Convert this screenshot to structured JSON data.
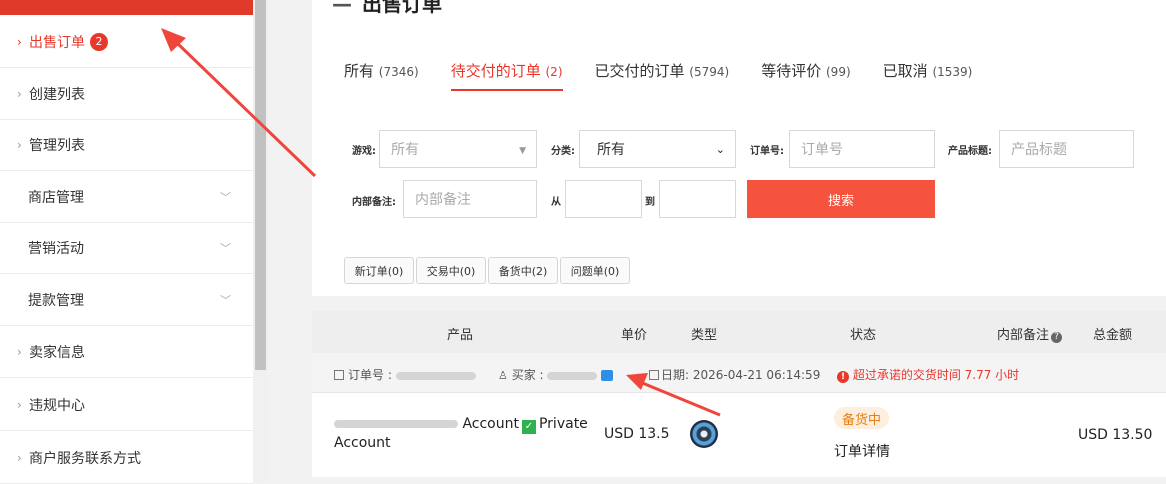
{
  "sidebar": {
    "items": [
      {
        "label": "出售订单",
        "badge": "2"
      },
      {
        "label": "创建列表"
      },
      {
        "label": "管理列表"
      },
      {
        "label": "商店管理"
      },
      {
        "label": "营销活动"
      },
      {
        "label": "提款管理"
      },
      {
        "label": "卖家信息"
      },
      {
        "label": "违规中心"
      },
      {
        "label": "商户服务联系方式"
      }
    ]
  },
  "page": {
    "title": "出售订单"
  },
  "tabs": [
    {
      "label": "所有",
      "count": "(7346)"
    },
    {
      "label": "待交付的订单",
      "count": "(2)"
    },
    {
      "label": "已交付的订单",
      "count": "(5794)"
    },
    {
      "label": "等待评价",
      "count": "(99)"
    },
    {
      "label": "已取消",
      "count": "(1539)"
    }
  ],
  "filters": {
    "game_label": "游戏:",
    "game_placeholder": "所有",
    "category_label": "分类:",
    "category_value": "所有",
    "order_no_label": "订单号:",
    "order_no_placeholder": "订单号",
    "product_title_label": "产品标题:",
    "product_title_placeholder": "产品标题",
    "note_label": "内部备注:",
    "note_placeholder": "内部备注",
    "from_label": "从",
    "to_label": "到",
    "search_label": "搜索"
  },
  "status_filters": [
    "新订单(0)",
    "交易中(0)",
    "备货中(2)",
    "问题单(0)"
  ],
  "table": {
    "headers": {
      "product": "产品",
      "unit_price": "单价",
      "type": "类型",
      "status": "状态",
      "note": "内部备注",
      "total": "总金额"
    }
  },
  "order": {
    "order_no_label": "订单号 :",
    "buyer_label": "买家 :",
    "date_label": "日期:",
    "date_value": "2026-04-21 06:14:59",
    "warning": "超过承诺的交货时间 7.77 小时",
    "product_line1": "Account",
    "product_private": "Private",
    "product_line2": "Account",
    "unit_price": "USD 13.5",
    "status": "备货中",
    "detail_link": "订单详情",
    "total": "USD 13.50"
  },
  "colors": {
    "accent": "#e8372b",
    "search_button": "#f5533d",
    "status_badge_text": "#e87f14",
    "annotation_arrow": "#f0453a"
  }
}
